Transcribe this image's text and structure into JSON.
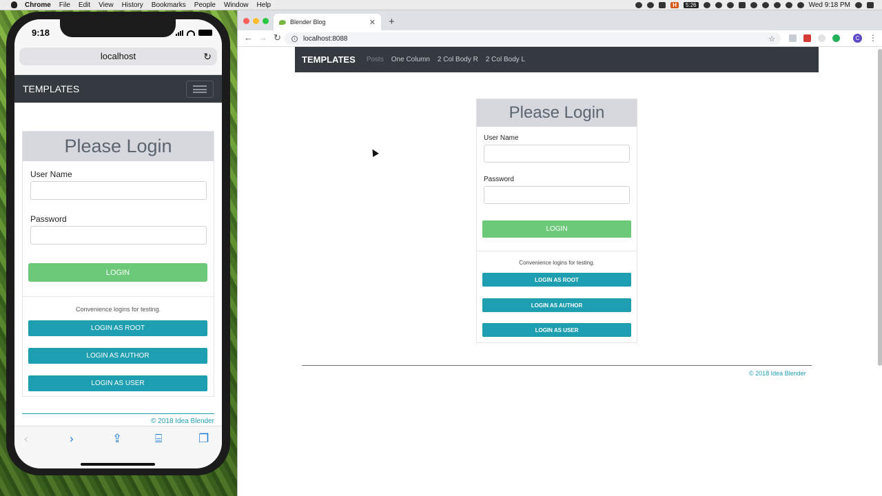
{
  "menubar": {
    "app": "Chrome",
    "items": [
      "File",
      "Edit",
      "View",
      "History",
      "Bookmarks",
      "People",
      "Window",
      "Help"
    ],
    "h_badge": "H",
    "time_badge": "5:26",
    "clock": "Wed 9:18 PM"
  },
  "phone": {
    "time": "9:18",
    "url": "localhost",
    "brand": "TEMPLATES",
    "card_title": "Please Login",
    "username_label": "User Name",
    "password_label": "Password",
    "login_label": "LOGIN",
    "note": "Convenience logins for testing.",
    "test_buttons": [
      "LOGIN AS ROOT",
      "LOGIN AS AUTHOR",
      "LOGIN AS USER"
    ],
    "footer": "© 2018 Idea Blender"
  },
  "browser": {
    "tab_title": "Blender Blog",
    "url": "localhost:8088",
    "profile_initial": "C"
  },
  "site": {
    "brand": "TEMPLATES",
    "nav_links": [
      "Posts",
      "One Column",
      "2 Col Body R",
      "2 Col Body L"
    ],
    "card_title": "Please Login",
    "username_label": "User Name",
    "password_label": "Password",
    "login_label": "LOGIN",
    "note": "Convenience logins for testing.",
    "test_buttons": [
      "LOGIN AS ROOT",
      "LOGIN AS AUTHOR",
      "LOGIN AS USER"
    ],
    "footer": "© 2018 Idea Blender"
  },
  "colors": {
    "navbar": "#343a40",
    "login_button": "#6cc97a",
    "test_button": "#1e9fb1",
    "card_header": "#d6d8de"
  }
}
